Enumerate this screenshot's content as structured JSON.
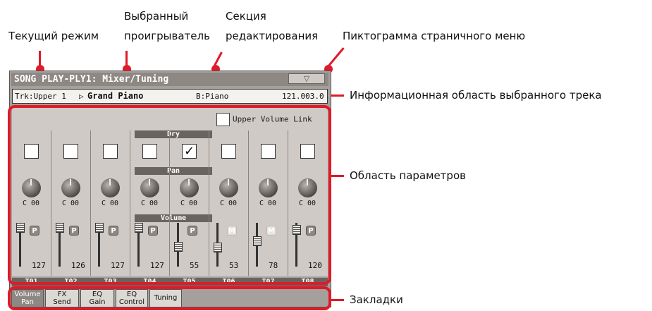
{
  "annotations": {
    "current_mode": "Текущий режим",
    "selected_player_1": "Выбранный",
    "selected_player_2": "проигрыватель",
    "edit_section_1": "Секция",
    "edit_section_2": "редактирования",
    "page_menu_icon": "Пиктограмма страничного меню",
    "track_info_area": "Информационная область выбранного трека",
    "param_area": "Область параметров",
    "tabs": "Закладки"
  },
  "screen": {
    "title": "SONG PLAY-PLY1: Mixer/Tuning",
    "menu_icon": "▽",
    "track_info": {
      "track": "Trk:Upper 1",
      "sound_marker": "▷",
      "sound": "Grand Piano",
      "bank": "B:Piano",
      "position": "121.003.0"
    },
    "upper_volume_link": "Upper Volume Link",
    "dry_label": "Dry",
    "pan_label": "Pan",
    "volume_label": "Volume",
    "check_mark": "✓",
    "play_marker": "P",
    "mute_marker": "M",
    "channels": [
      {
        "name": "T01",
        "dry": false,
        "pan": "C 00",
        "volume": "127",
        "fader_level": 1.0,
        "state": "P"
      },
      {
        "name": "T02",
        "dry": false,
        "pan": "C 00",
        "volume": "126",
        "fader_level": 0.99,
        "state": "P"
      },
      {
        "name": "T03",
        "dry": false,
        "pan": "C 00",
        "volume": "127",
        "fader_level": 1.0,
        "state": "P"
      },
      {
        "name": "T04",
        "dry": false,
        "pan": "C 00",
        "volume": "127",
        "fader_level": 1.0,
        "state": "P"
      },
      {
        "name": "T05",
        "dry": true,
        "pan": "C 00",
        "volume": "55",
        "fader_level": 0.43,
        "state": "P"
      },
      {
        "name": "T06",
        "dry": false,
        "pan": "C 00",
        "volume": "53",
        "fader_level": 0.42,
        "state": "M"
      },
      {
        "name": "T07",
        "dry": false,
        "pan": "C 00",
        "volume": "78",
        "fader_level": 0.61,
        "state": "M"
      },
      {
        "name": "T08",
        "dry": false,
        "pan": "C 00",
        "volume": "120",
        "fader_level": 0.94,
        "state": "P"
      }
    ],
    "tabs": [
      {
        "line1": "Volume",
        "line2": "Pan",
        "selected": true
      },
      {
        "line1": "FX",
        "line2": "Send",
        "selected": false
      },
      {
        "line1": "EQ",
        "line2": "Gain",
        "selected": false
      },
      {
        "line1": "EQ",
        "line2": "Control",
        "selected": false
      },
      {
        "line1": "Tuning",
        "line2": "",
        "selected": false
      }
    ]
  },
  "colors": {
    "accent_red": "#e01a28",
    "screen_bg": "#a6a09c",
    "param_bg": "#cfcac6",
    "header_bar": "#6a6461"
  }
}
